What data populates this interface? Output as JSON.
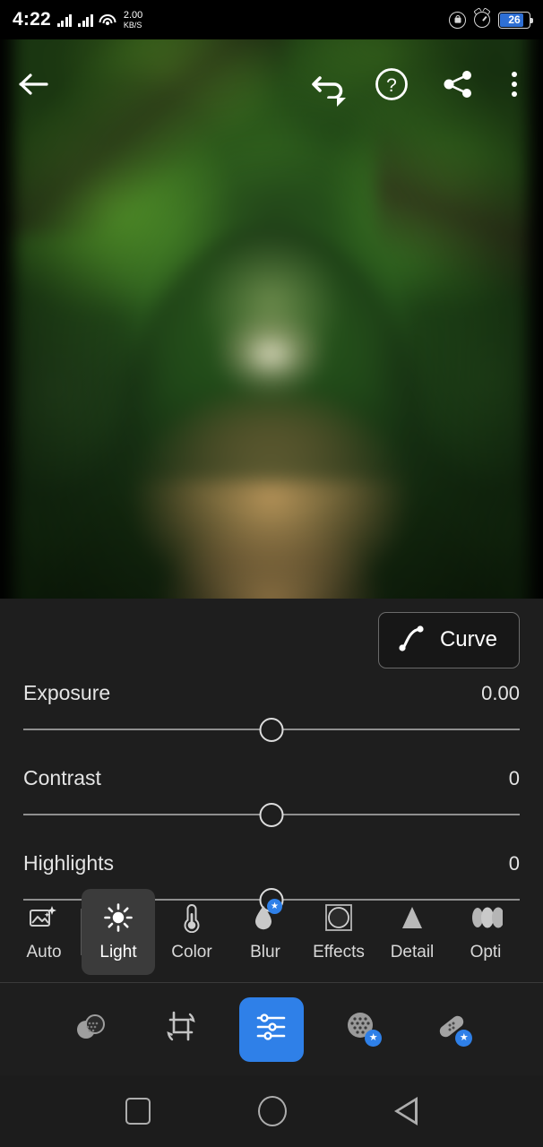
{
  "statusbar": {
    "time": "4:22",
    "net_speed_value": "2.00",
    "net_speed_unit": "KB/S",
    "battery_percent": "26",
    "icons": [
      "signal-bars-sim1",
      "signal-bars-sim2",
      "wifi-icon",
      "lock-icon",
      "alarm-icon",
      "battery-icon"
    ]
  },
  "topbar": {
    "back": "back-arrow-icon",
    "undo": "undo-icon",
    "help": "help-icon",
    "share": "share-icon",
    "more": "more-options-icon"
  },
  "photo": {
    "description": "Blurred green tree tunnel with dirt path"
  },
  "panel": {
    "curve": {
      "label": "Curve",
      "icon": "tone-curve-icon"
    },
    "sliders": [
      {
        "name": "Exposure",
        "value": "0.00",
        "position": 50
      },
      {
        "name": "Contrast",
        "value": "0",
        "position": 50
      },
      {
        "name": "Highlights",
        "value": "0",
        "position": 50
      }
    ]
  },
  "categories": [
    {
      "label": "Auto",
      "icon": "auto-enhance-icon",
      "selected": false,
      "premium": false
    },
    {
      "label": "Light",
      "icon": "sun-icon",
      "selected": true,
      "premium": false
    },
    {
      "label": "Color",
      "icon": "thermometer-icon",
      "selected": false,
      "premium": false
    },
    {
      "label": "Blur",
      "icon": "blur-droplet-icon",
      "selected": false,
      "premium": true
    },
    {
      "label": "Effects",
      "icon": "vignette-icon",
      "selected": false,
      "premium": false
    },
    {
      "label": "Detail",
      "icon": "detail-triangle-icon",
      "selected": false,
      "premium": false
    },
    {
      "label": "Opti",
      "icon": "optics-lens-icon",
      "selected": false,
      "premium": false
    }
  ],
  "bottombar": [
    {
      "name": "presets-icon",
      "selected": false,
      "premium": false
    },
    {
      "name": "crop-icon",
      "selected": false,
      "premium": false
    },
    {
      "name": "edit-sliders-icon",
      "selected": true,
      "premium": false
    },
    {
      "name": "masking-icon",
      "selected": false,
      "premium": true
    },
    {
      "name": "healing-icon",
      "selected": false,
      "premium": true
    }
  ],
  "navbar": {
    "recents": "recents-square-icon",
    "home": "home-circle-icon",
    "back": "back-triangle-icon"
  },
  "colors": {
    "accent": "#2f80e8",
    "panel_bg": "#1e1e1e",
    "selected_chip": "#3b3b3b",
    "battery_fill": "#2e6fd4"
  }
}
